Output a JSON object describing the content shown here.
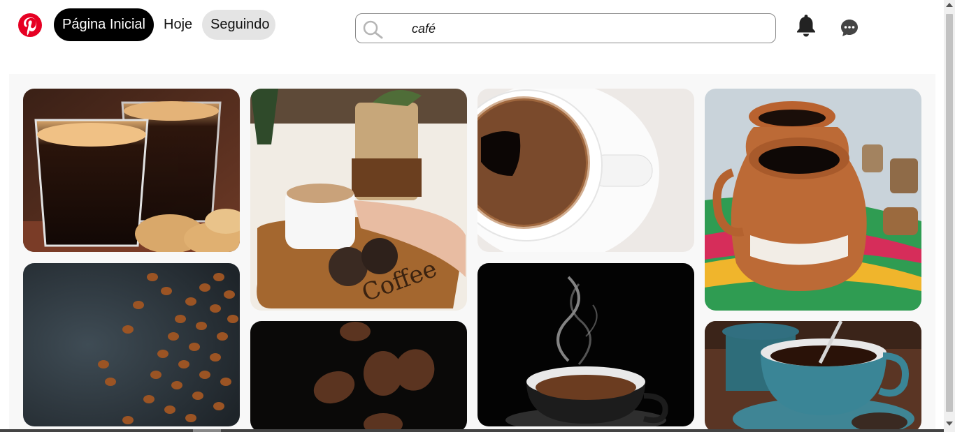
{
  "nav": {
    "home_label": "Página Inicial",
    "today_label": "Hoje",
    "following_label": "Seguindo"
  },
  "search": {
    "value": "café"
  },
  "icons": {
    "logo": "pinterest-logo",
    "search": "search-icon",
    "notifications": "bell-icon",
    "messages": "chat-bubble-icon"
  },
  "colors": {
    "brand": "#e60023",
    "active_tab_bg": "#000000",
    "inactive_tab_bg": "#e4e4e4"
  },
  "pins": [
    {
      "name": "espresso-glasses-with-cookies"
    },
    {
      "name": "coffee-cup-on-wooden-board"
    },
    {
      "name": "black-coffee-cup-top-view"
    },
    {
      "name": "clay-coffee-mugs"
    },
    {
      "name": "coffee-beans-on-dark-surface"
    },
    {
      "name": "floating-coffee-beans"
    },
    {
      "name": "steaming-cup-of-beans"
    },
    {
      "name": "blue-cup-with-spoon"
    }
  ]
}
